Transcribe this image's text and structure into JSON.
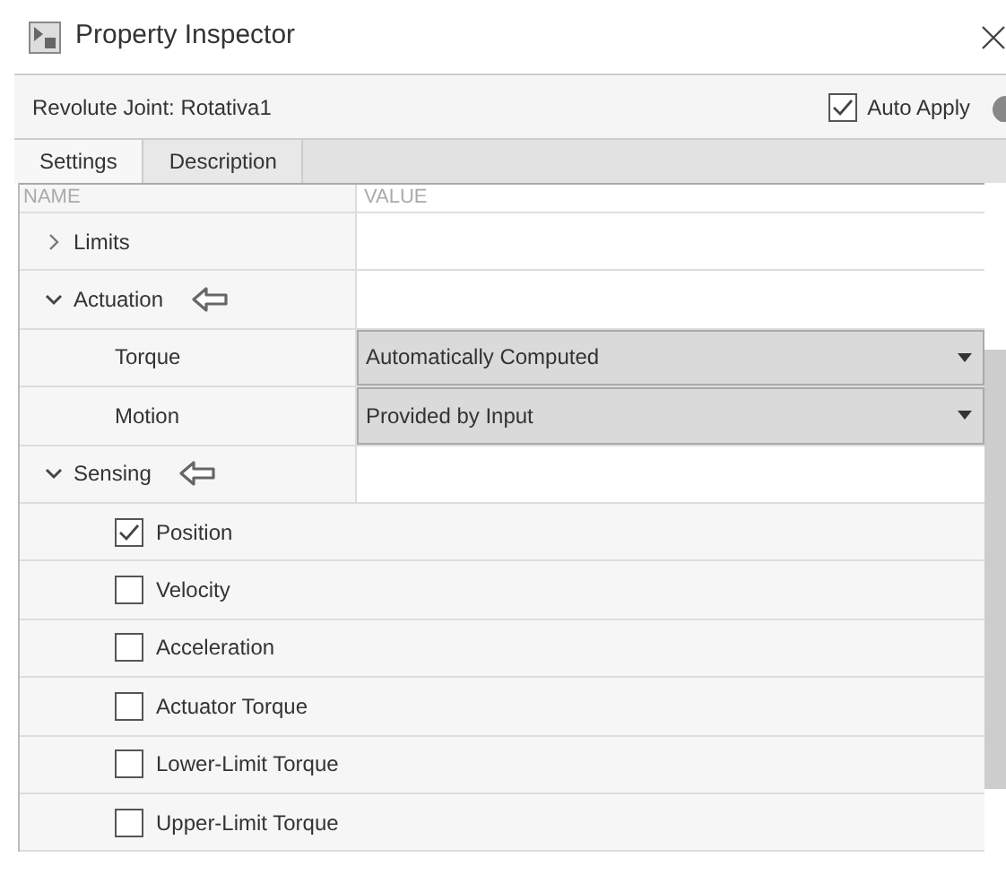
{
  "window": {
    "title": "Property Inspector"
  },
  "header": {
    "title": "Revolute Joint: Rotativa1",
    "auto_apply": {
      "label": "Auto Apply",
      "checked": true
    }
  },
  "tabs": [
    {
      "label": "Settings",
      "selected": true
    },
    {
      "label": "Description",
      "selected": false
    }
  ],
  "table": {
    "columns": [
      "NAME",
      "VALUE"
    ],
    "rows": [
      {
        "kind": "group",
        "label": "Limits",
        "expanded": false,
        "pointer_arrow": false
      },
      {
        "kind": "group",
        "label": "Actuation",
        "expanded": true,
        "pointer_arrow": true
      },
      {
        "kind": "dropdown",
        "label": "Torque",
        "value": "Automatically Computed"
      },
      {
        "kind": "dropdown",
        "label": "Motion",
        "value": "Provided by Input"
      },
      {
        "kind": "group",
        "label": "Sensing",
        "expanded": true,
        "pointer_arrow": true
      },
      {
        "kind": "checkbox",
        "label": "Position",
        "checked": true
      },
      {
        "kind": "checkbox",
        "label": "Velocity",
        "checked": false
      },
      {
        "kind": "checkbox",
        "label": "Acceleration",
        "checked": false
      },
      {
        "kind": "checkbox",
        "label": "Actuator Torque",
        "checked": false
      },
      {
        "kind": "checkbox",
        "label": "Lower-Limit Torque",
        "checked": false
      },
      {
        "kind": "checkbox",
        "label": "Upper-Limit Torque",
        "checked": false
      }
    ]
  }
}
